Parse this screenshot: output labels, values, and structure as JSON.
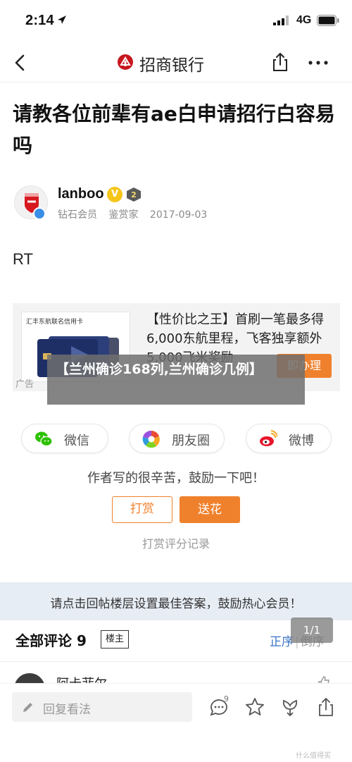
{
  "status_bar": {
    "time": "2:14",
    "network": "4G"
  },
  "nav": {
    "title": "招商银行"
  },
  "post": {
    "title": "请教各位前辈有ae白申请招行白容易吗",
    "author": "lanboo",
    "vip_badge": "V",
    "level": "2",
    "rank": "钻石会员",
    "role": "鉴赏家",
    "date": "2017-09-03",
    "body": "RT"
  },
  "ad": {
    "card_title": "汇丰东航联名信用卡",
    "text": "【性价比之王】首刷一笔最多得6,000东航里程，飞客独享额外5,000飞米奖励",
    "label": "广告",
    "button": "即办理"
  },
  "overlay": {
    "text": "【兰州确诊168列,兰州确诊几例】"
  },
  "share": {
    "wechat": "微信",
    "moments": "朋友圈",
    "weibo": "微博"
  },
  "reward": {
    "note": "作者写的很辛苦，鼓励一下吧！",
    "tip_label": "打赏",
    "gift_label": "送花",
    "record_label": "打赏评分记录"
  },
  "hint": {
    "text": "请点击回帖楼层设置最佳答案，鼓励热心会员！"
  },
  "comments": {
    "title": "全部评论 9",
    "op_filter": "楼主",
    "order_label": "正序",
    "reverse_label": "倒序",
    "page_indicator": "1/1",
    "first_author": "阿卡菲尔"
  },
  "bottom_bar": {
    "reply_placeholder": "回复看法",
    "comment_count": "9",
    "watermark": "什么值得买"
  },
  "colors": {
    "accent_orange": "#f0812c",
    "link_blue": "#3b73c4",
    "hint_bg": "#e7edf4"
  }
}
